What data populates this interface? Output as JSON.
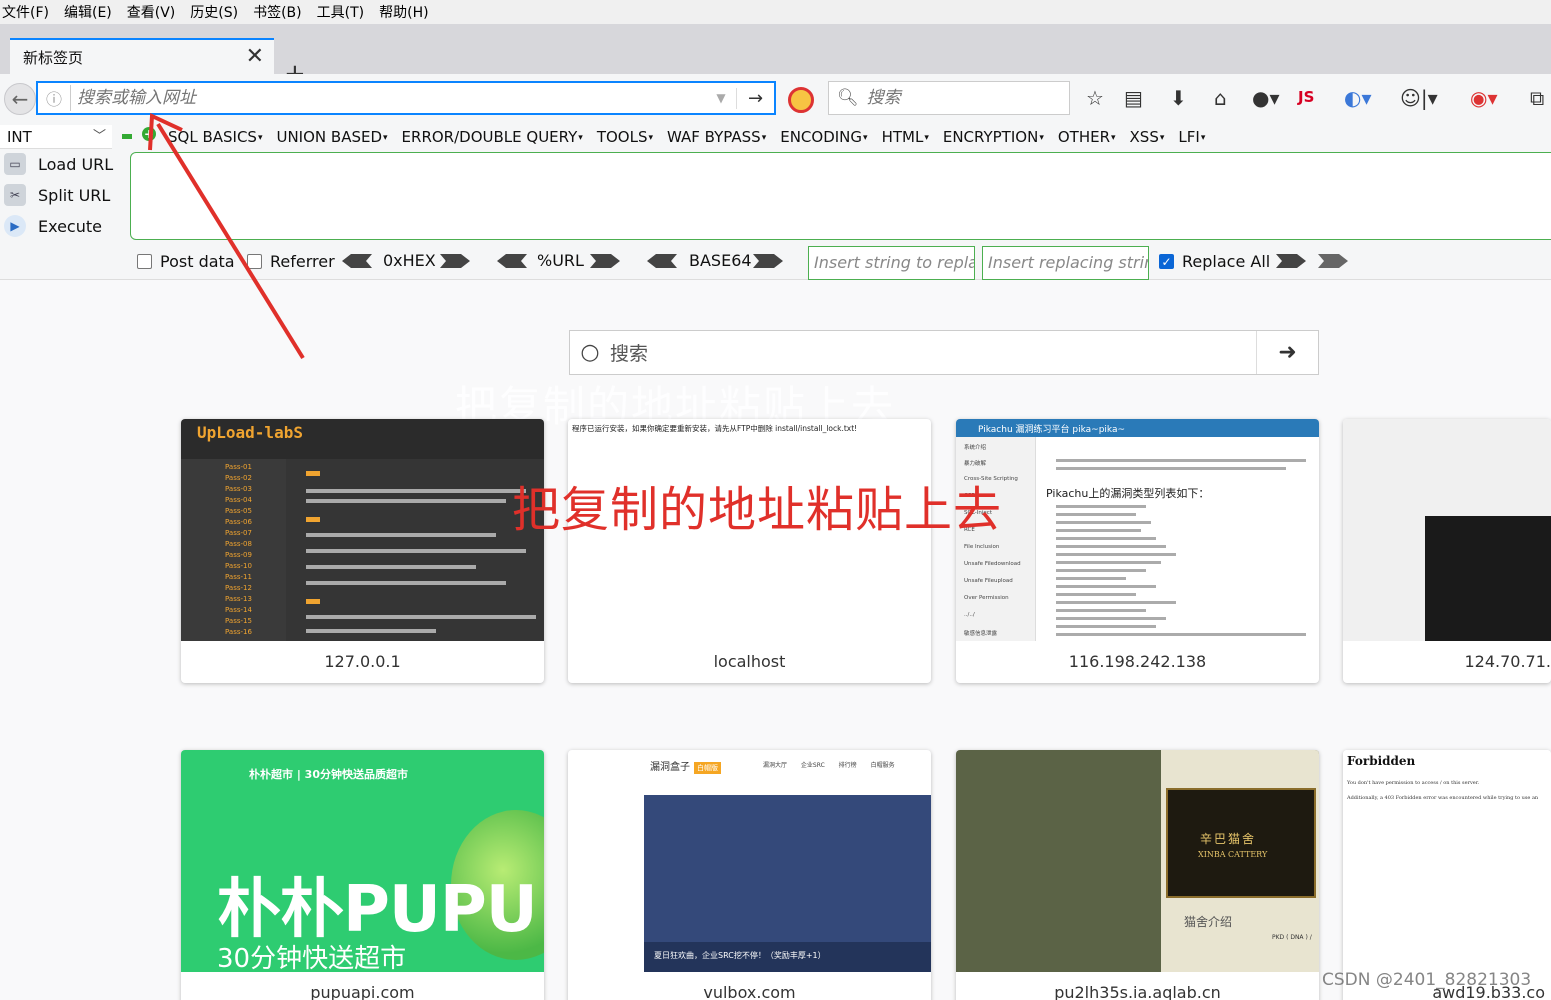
{
  "menubar": [
    "文件(F)",
    "编辑(E)",
    "查看(V)",
    "历史(S)",
    "书签(B)",
    "工具(T)",
    "帮助(H)"
  ],
  "tab": {
    "title": "新标签页"
  },
  "urlbar": {
    "placeholder": "搜索或输入网址"
  },
  "searchbar": {
    "placeholder": "搜索"
  },
  "toolbar": {
    "js_label": "JS"
  },
  "hackbar": {
    "type_select": "INT",
    "menus": [
      "SQL BASICS",
      "UNION BASED",
      "ERROR/DOUBLE QUERY",
      "TOOLS",
      "WAF BYPASS",
      "ENCODING",
      "HTML",
      "ENCRYPTION",
      "OTHER",
      "XSS",
      "LFI"
    ],
    "load_url": "Load URL",
    "split_url": "Split URL",
    "execute": "Execute",
    "post_data": "Post data",
    "referrer": "Referrer",
    "hex": "0xHEX",
    "url_enc": "%URL",
    "base64": "BASE64",
    "replace_placeholder": "Insert string to replace",
    "replacing_placeholder": "Insert replacing string",
    "replace_all": "Replace All",
    "replace_all_checked": true
  },
  "newtab": {
    "search_placeholder": "搜索",
    "ghost_text": "把复制的地址粘贴上去",
    "tiles": [
      {
        "label": "127.0.0.1"
      },
      {
        "label": "localhost"
      },
      {
        "label": "116.198.242.138"
      },
      {
        "label": "124.70.71."
      },
      {
        "label": "pupuapi.com"
      },
      {
        "label": "vulbox.com"
      },
      {
        "label": "pu2lh35s.ia.aqlab.cn"
      },
      {
        "label": "awd19.b33.co"
      }
    ],
    "tile1": {
      "logo": "UpLoad-labS",
      "passes": [
        "Pass-01",
        "Pass-02",
        "Pass-03",
        "Pass-04",
        "Pass-05",
        "Pass-06",
        "Pass-07",
        "Pass-08",
        "Pass-09",
        "Pass-10",
        "Pass-11",
        "Pass-12",
        "Pass-13",
        "Pass-14",
        "Pass-15",
        "Pass-16"
      ]
    },
    "tile2": {
      "topline": "程序已运行安装，如果你确定要重新安装，请先从FTP中删除 install/install_lock.txt!"
    },
    "tile3": {
      "header": "Pikachu 漏洞练习平台 pika~pika~",
      "heading": "Pikachu上的漏洞类型列表如下：",
      "menu": [
        "系统介绍",
        "暴力破解",
        "Cross-Site Scripting",
        "CSRF",
        "SQL-Inject",
        "RCE",
        "File Inclusion",
        "Unsafe Filedownload",
        "Unsafe Fileupload",
        "Over Permission",
        "../../",
        "敏感信息泄露"
      ]
    },
    "tile5": {
      "brand": "朴朴超市 | 30分钟快送品质超市",
      "big": "朴朴PUPU",
      "sub": "30分钟快送超市"
    },
    "tile6": {
      "brand": "漏洞盒子",
      "badge": "白帽版",
      "nav": "漏洞大厅 企业SRC 排行榜 白帽服务",
      "msg": "夏日狂欢曲，企业SRC挖不停！（奖励丰厚+1）"
    },
    "tile7": {
      "sign_cn": "辛巴猫舍",
      "sign_en": "XINBA CATTERY",
      "intro": "猫舍介绍",
      "pkd": "PKD ( DNA ) /"
    },
    "tile8": {
      "heading": "Forbidden",
      "line1": "You don't have permission to access / on this server.",
      "line2": "Additionally, a 403 Forbidden error was encountered while trying to use an"
    }
  },
  "annotation": {
    "text": "把复制的地址粘贴上去",
    "color": "#e0302a"
  },
  "watermark": "CSDN @2401_82821303",
  "colors": {
    "accent": "#0a84ff",
    "hackbar_green": "#4caf50",
    "annotation_red": "#e0302a"
  }
}
